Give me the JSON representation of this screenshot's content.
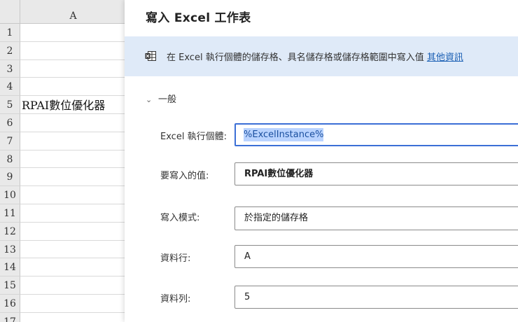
{
  "spreadsheet": {
    "column_header": "A",
    "rows": [
      {
        "num": "1",
        "value": ""
      },
      {
        "num": "2",
        "value": ""
      },
      {
        "num": "3",
        "value": ""
      },
      {
        "num": "4",
        "value": ""
      },
      {
        "num": "5",
        "value": "RPAI數位優化器"
      },
      {
        "num": "6",
        "value": ""
      },
      {
        "num": "7",
        "value": ""
      },
      {
        "num": "8",
        "value": ""
      },
      {
        "num": "9",
        "value": ""
      },
      {
        "num": "10",
        "value": ""
      },
      {
        "num": "11",
        "value": ""
      },
      {
        "num": "12",
        "value": ""
      },
      {
        "num": "13",
        "value": ""
      },
      {
        "num": "14",
        "value": ""
      },
      {
        "num": "15",
        "value": ""
      },
      {
        "num": "16",
        "value": ""
      },
      {
        "num": "17",
        "value": ""
      }
    ]
  },
  "dialog": {
    "title": "寫入 Excel 工作表",
    "banner": {
      "icon": "excel-sheet-icon",
      "text": "在 Excel 執行個體的儲存格、具名儲存格或儲存格範圍中寫入值 ",
      "link": "其他資訊"
    },
    "section_title": "一般",
    "fields": {
      "instance": {
        "label": "Excel 執行個體:",
        "value": "%ExcelInstance%"
      },
      "value_to_write": {
        "label": "要寫入的值:",
        "value": "RPAI數位優化器"
      },
      "write_mode": {
        "label": "寫入模式:",
        "value": "於指定的儲存格"
      },
      "column": {
        "label": "資料行:",
        "value": "A"
      },
      "row": {
        "label": "資料列:",
        "value": "5"
      }
    }
  },
  "colors": {
    "banner_bg": "#dfeaf8",
    "link": "#1a5fb4",
    "focus_border": "#3b6fd6",
    "selection": "#b9d3ff",
    "header_bg": "#e9e9e9"
  }
}
